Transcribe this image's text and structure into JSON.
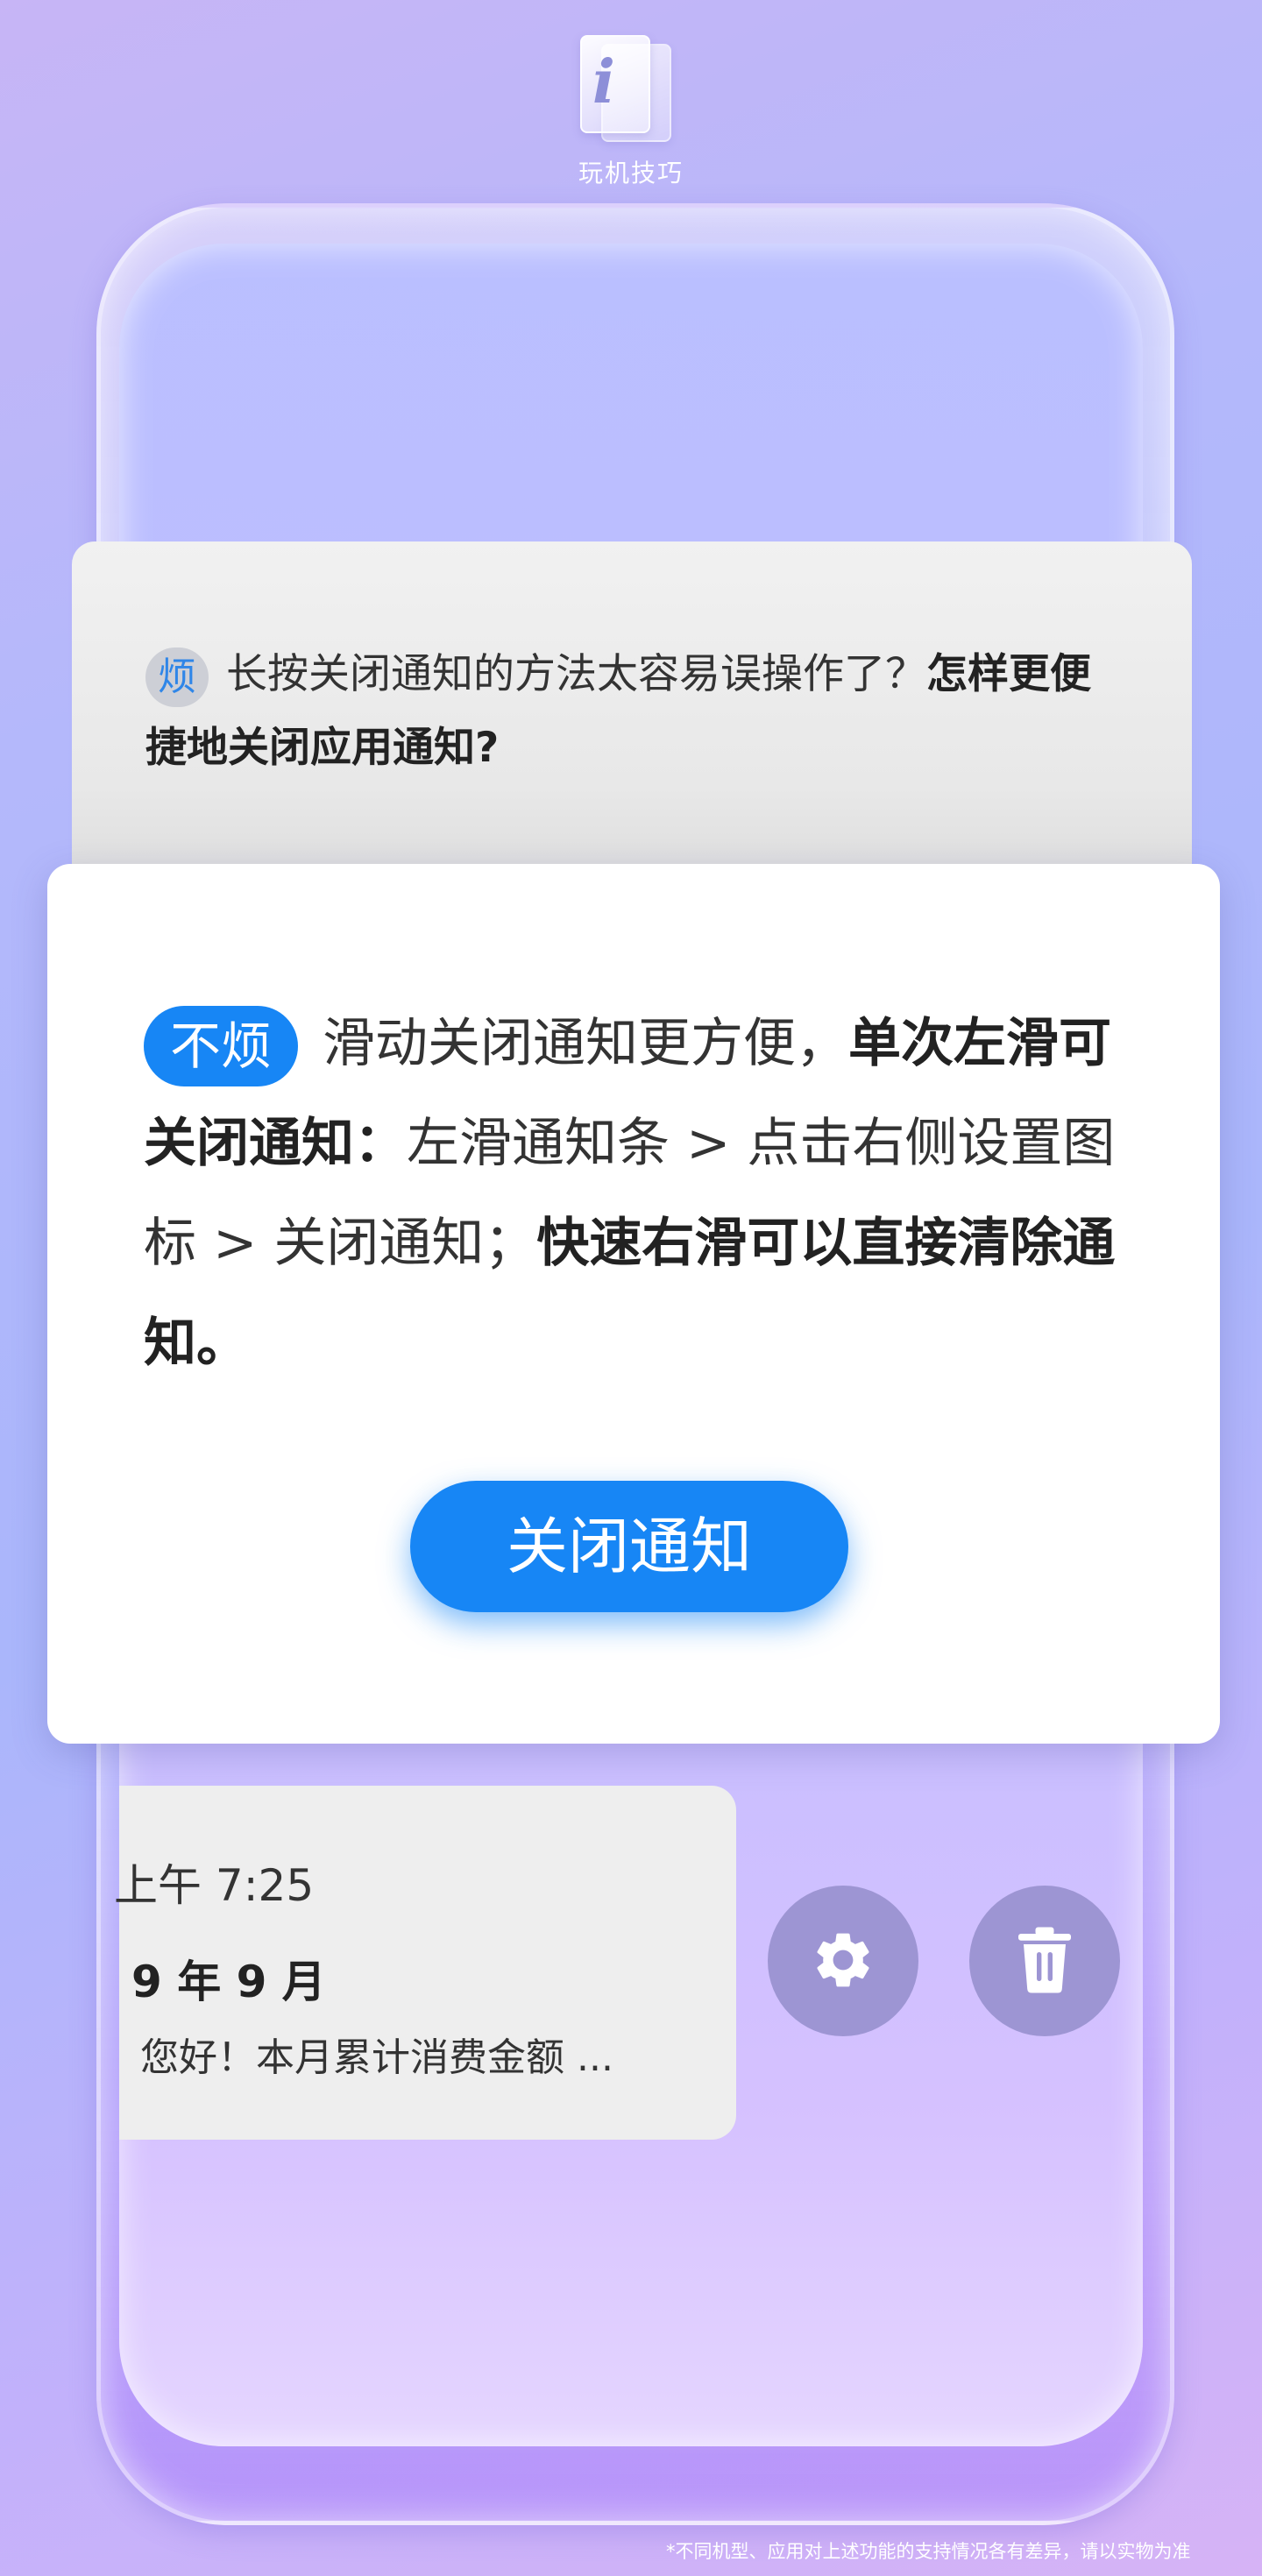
{
  "header": {
    "title": "玩机技巧",
    "logo_letter": "i"
  },
  "annoyed_card": {
    "tag": "烦",
    "text_normal": "长按关闭通知的方法太容易误操作了？",
    "text_bold": "怎样更便捷地关闭应用通知?"
  },
  "solution_card": {
    "tag": "不烦",
    "part1": "滑动关闭通知更方便，",
    "part2_bold": "单次左滑可关闭通知：",
    "part3": "左滑通知条 > 点击右侧设置图标 > 关闭通知；",
    "part4_bold": "快速右滑可以直接清除通知。",
    "button_label": "关闭通知"
  },
  "notification": {
    "time": "上午 7:25",
    "title": "9 年 9 月",
    "body": "您好！本月累计消费金额 ..."
  },
  "actions": {
    "settings_icon": "gear-icon",
    "delete_icon": "trash-icon"
  },
  "footnote": "*不同机型、应用对上述功能的支持情况各有差异，请以实物为准",
  "colors": {
    "accent": "#1786f5",
    "action_button": "#9d95d3",
    "tag_gray": "#cdcfd6"
  }
}
